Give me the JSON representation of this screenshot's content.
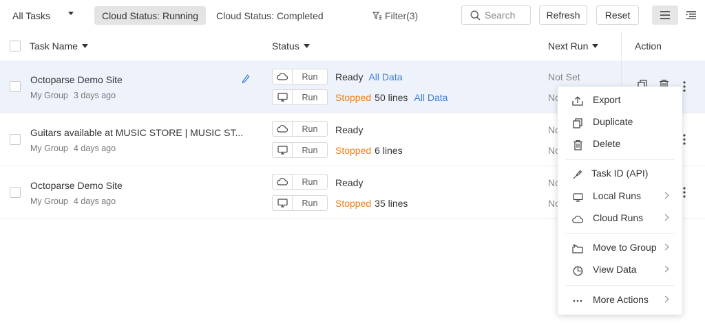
{
  "toolbar": {
    "all_tasks": "All Tasks",
    "chip_running": "Cloud Status: Running",
    "chip_completed": "Cloud Status: Completed",
    "filter": "Filter(3)",
    "search_placeholder": "Search",
    "refresh": "Refresh",
    "reset": "Reset"
  },
  "header": {
    "task_name": "Task Name",
    "status": "Status",
    "next_run": "Next Run",
    "action": "Action"
  },
  "rows": [
    {
      "name": "Octoparse Demo Site",
      "group": "My Group",
      "age": "3 days ago",
      "cloud_run": "Run",
      "local_run": "Run",
      "cloud_status": "Ready",
      "cloud_link": "All Data",
      "local_status": "Stopped",
      "local_lines": "50 lines",
      "local_link": "All Data",
      "next_run_1": "Not Set",
      "next_run_2": "No"
    },
    {
      "name": "Guitars available at MUSIC STORE | MUSIC ST...",
      "group": "My Group",
      "age": "4 days ago",
      "cloud_run": "Run",
      "local_run": "Run",
      "cloud_status": "Ready",
      "local_status": "Stopped",
      "local_lines": "6 lines",
      "next_run_1": "No",
      "next_run_2": "No"
    },
    {
      "name": "Octoparse Demo Site",
      "group": "My Group",
      "age": "4 days ago",
      "cloud_run": "Run",
      "local_run": "Run",
      "cloud_status": "Ready",
      "local_status": "Stopped",
      "local_lines": "35 lines",
      "next_run_1": "No",
      "next_run_2": "No"
    }
  ],
  "menu": {
    "export": "Export",
    "duplicate": "Duplicate",
    "delete": "Delete",
    "task_id": "Task ID (API)",
    "local_runs": "Local Runs",
    "cloud_runs": "Cloud Runs",
    "move_to_group": "Move to Group",
    "view_data": "View Data",
    "more_actions": "More Actions"
  },
  "colors": {
    "accent_blue": "#3d7fd9",
    "stopped_orange": "#f07c12",
    "selected_row": "#eef3fb"
  }
}
